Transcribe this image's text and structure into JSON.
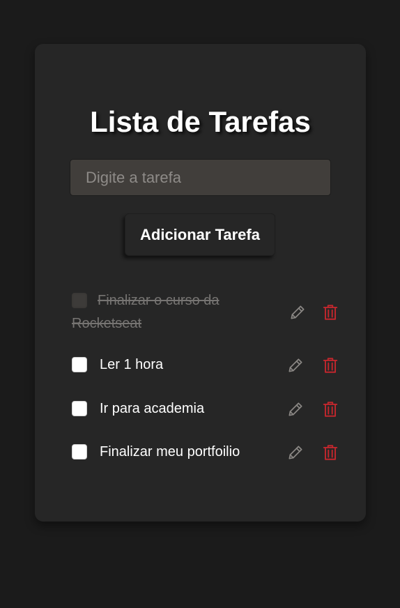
{
  "header": {
    "title": "Lista de Tarefas"
  },
  "form": {
    "placeholder": "Digite a tarefa",
    "value": "",
    "add_button_label": "Adicionar Tarefa"
  },
  "tasks": [
    {
      "text": "Finalizar o curso da Rocketseat",
      "completed": true
    },
    {
      "text": "Ler 1 hora",
      "completed": false
    },
    {
      "text": "Ir para academia",
      "completed": false
    },
    {
      "text": "Finalizar meu portfoilio",
      "completed": false
    }
  ],
  "icons": {
    "edit": "pencil-icon",
    "delete": "trash-icon"
  },
  "colors": {
    "background": "#1b1b1b",
    "card": "#262626",
    "input": "#413e3b",
    "delete": "#c0272d",
    "edit": "#8a8784",
    "completed_text": "#767472"
  }
}
